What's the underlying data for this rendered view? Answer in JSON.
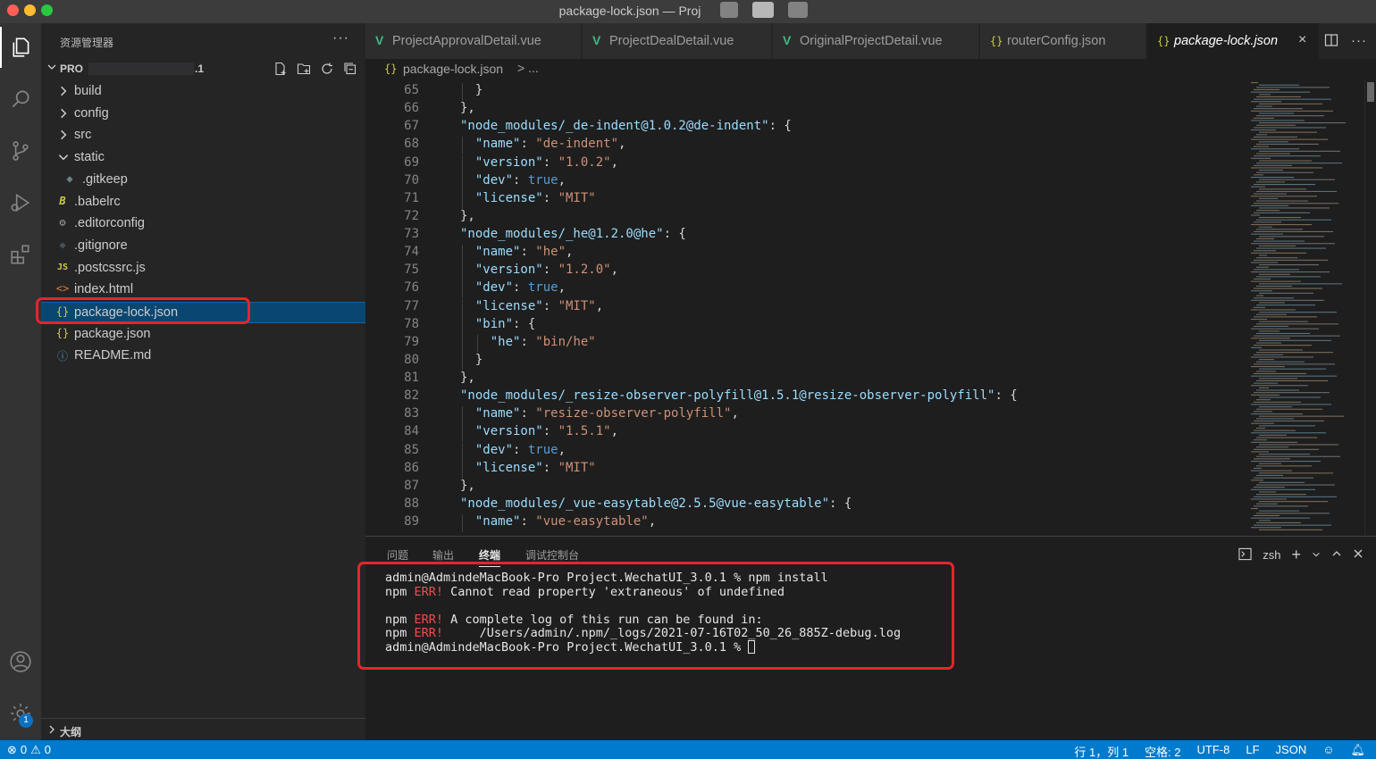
{
  "window": {
    "title": "package-lock.json — Proj"
  },
  "sidebar": {
    "title": "资源管理器",
    "more": "···",
    "project_prefix": "PRO",
    "project_suffix": ".1",
    "tree": [
      {
        "label": "build",
        "type": "folder",
        "expanded": false
      },
      {
        "label": "config",
        "type": "folder",
        "expanded": false
      },
      {
        "label": "src",
        "type": "folder",
        "expanded": false
      },
      {
        "label": "static",
        "type": "folder",
        "expanded": true
      },
      {
        "label": ".gitkeep",
        "type": "file",
        "icon": "◆",
        "icon_color": "#6d8086"
      },
      {
        "label": ".babelrc",
        "type": "file",
        "icon": "B",
        "icon_color": "#cbcb41"
      },
      {
        "label": ".editorconfig",
        "type": "file",
        "icon": "⚙",
        "icon_color": "#9d9d9d"
      },
      {
        "label": ".gitignore",
        "type": "file",
        "icon": "◆",
        "icon_color": "#41535b"
      },
      {
        "label": ".postcssrc.js",
        "type": "file",
        "icon": "JS",
        "icon_color": "#cbcb41"
      },
      {
        "label": "index.html",
        "type": "file",
        "icon": "<>",
        "icon_color": "#e37933"
      },
      {
        "label": "package-lock.json",
        "type": "file",
        "icon": "{}",
        "icon_color": "#cbcb41",
        "selected": true
      },
      {
        "label": "package.json",
        "type": "file",
        "icon": "{}",
        "icon_color": "#cbcb41"
      },
      {
        "label": "README.md",
        "type": "file",
        "icon": "ⓘ",
        "icon_color": "#519aba"
      }
    ],
    "outline_label": "大纲"
  },
  "tabs": [
    {
      "label": "ProjectApprovalDetail.vue",
      "kind": "vue"
    },
    {
      "label": "ProjectDealDetail.vue",
      "kind": "vue"
    },
    {
      "label": "OriginalProjectDetail.vue",
      "kind": "vue"
    },
    {
      "label": "routerConfig.json",
      "kind": "json"
    },
    {
      "label": "package-lock.json",
      "kind": "json",
      "active": true
    }
  ],
  "breadcrumb": {
    "file": "package-lock.json",
    "sep": "> ..."
  },
  "editor": {
    "lines": [
      {
        "n": "65",
        "indent": 2,
        "parts": [
          [
            "p",
            "}"
          ]
        ]
      },
      {
        "n": "66",
        "indent": 1,
        "parts": [
          [
            "p",
            "},"
          ]
        ]
      },
      {
        "n": "67",
        "indent": 1,
        "parts": [
          [
            "k",
            "\"node_modules/_de-indent@1.0.2@de-indent\""
          ],
          [
            "p",
            ": {"
          ]
        ]
      },
      {
        "n": "68",
        "indent": 2,
        "parts": [
          [
            "k",
            "\"name\""
          ],
          [
            "p",
            ": "
          ],
          [
            "s",
            "\"de-indent\""
          ],
          [
            "p",
            ","
          ]
        ]
      },
      {
        "n": "69",
        "indent": 2,
        "parts": [
          [
            "k",
            "\"version\""
          ],
          [
            "p",
            ": "
          ],
          [
            "s",
            "\"1.0.2\""
          ],
          [
            "p",
            ","
          ]
        ]
      },
      {
        "n": "70",
        "indent": 2,
        "parts": [
          [
            "k",
            "\"dev\""
          ],
          [
            "p",
            ": "
          ],
          [
            "b",
            "true"
          ],
          [
            "p",
            ","
          ]
        ]
      },
      {
        "n": "71",
        "indent": 2,
        "parts": [
          [
            "k",
            "\"license\""
          ],
          [
            "p",
            ": "
          ],
          [
            "s",
            "\"MIT\""
          ]
        ]
      },
      {
        "n": "72",
        "indent": 1,
        "parts": [
          [
            "p",
            "},"
          ]
        ]
      },
      {
        "n": "73",
        "indent": 1,
        "parts": [
          [
            "k",
            "\"node_modules/_he@1.2.0@he\""
          ],
          [
            "p",
            ": {"
          ]
        ]
      },
      {
        "n": "74",
        "indent": 2,
        "parts": [
          [
            "k",
            "\"name\""
          ],
          [
            "p",
            ": "
          ],
          [
            "s",
            "\"he\""
          ],
          [
            "p",
            ","
          ]
        ]
      },
      {
        "n": "75",
        "indent": 2,
        "parts": [
          [
            "k",
            "\"version\""
          ],
          [
            "p",
            ": "
          ],
          [
            "s",
            "\"1.2.0\""
          ],
          [
            "p",
            ","
          ]
        ]
      },
      {
        "n": "76",
        "indent": 2,
        "parts": [
          [
            "k",
            "\"dev\""
          ],
          [
            "p",
            ": "
          ],
          [
            "b",
            "true"
          ],
          [
            "p",
            ","
          ]
        ]
      },
      {
        "n": "77",
        "indent": 2,
        "parts": [
          [
            "k",
            "\"license\""
          ],
          [
            "p",
            ": "
          ],
          [
            "s",
            "\"MIT\""
          ],
          [
            "p",
            ","
          ]
        ]
      },
      {
        "n": "78",
        "indent": 2,
        "parts": [
          [
            "k",
            "\"bin\""
          ],
          [
            "p",
            ": {"
          ]
        ]
      },
      {
        "n": "79",
        "indent": 3,
        "parts": [
          [
            "k",
            "\"he\""
          ],
          [
            "p",
            ": "
          ],
          [
            "s",
            "\"bin/he\""
          ]
        ]
      },
      {
        "n": "80",
        "indent": 2,
        "parts": [
          [
            "p",
            "}"
          ]
        ]
      },
      {
        "n": "81",
        "indent": 1,
        "parts": [
          [
            "p",
            "},"
          ]
        ]
      },
      {
        "n": "82",
        "indent": 1,
        "parts": [
          [
            "k",
            "\"node_modules/_resize-observer-polyfill@1.5.1@resize-observer-polyfill\""
          ],
          [
            "p",
            ": {"
          ]
        ]
      },
      {
        "n": "83",
        "indent": 2,
        "parts": [
          [
            "k",
            "\"name\""
          ],
          [
            "p",
            ": "
          ],
          [
            "s",
            "\"resize-observer-polyfill\""
          ],
          [
            "p",
            ","
          ]
        ]
      },
      {
        "n": "84",
        "indent": 2,
        "parts": [
          [
            "k",
            "\"version\""
          ],
          [
            "p",
            ": "
          ],
          [
            "s",
            "\"1.5.1\""
          ],
          [
            "p",
            ","
          ]
        ]
      },
      {
        "n": "85",
        "indent": 2,
        "parts": [
          [
            "k",
            "\"dev\""
          ],
          [
            "p",
            ": "
          ],
          [
            "b",
            "true"
          ],
          [
            "p",
            ","
          ]
        ]
      },
      {
        "n": "86",
        "indent": 2,
        "parts": [
          [
            "k",
            "\"license\""
          ],
          [
            "p",
            ": "
          ],
          [
            "s",
            "\"MIT\""
          ]
        ]
      },
      {
        "n": "87",
        "indent": 1,
        "parts": [
          [
            "p",
            "},"
          ]
        ]
      },
      {
        "n": "88",
        "indent": 1,
        "parts": [
          [
            "k",
            "\"node_modules/_vue-easytable@2.5.5@vue-easytable\""
          ],
          [
            "p",
            ": {"
          ]
        ]
      },
      {
        "n": "89",
        "indent": 2,
        "parts": [
          [
            "k",
            "\"name\""
          ],
          [
            "p",
            ": "
          ],
          [
            "s",
            "\"vue-easytable\""
          ],
          [
            "p",
            ","
          ]
        ]
      }
    ]
  },
  "panel": {
    "tabs": [
      {
        "label": "问题"
      },
      {
        "label": "输出"
      },
      {
        "label": "终端",
        "active": true
      },
      {
        "label": "调试控制台"
      }
    ],
    "shell": "zsh",
    "terminal": [
      [
        [
          "t",
          "admin@AdmindeMacBook-Pro Project.WechatUI_3.0.1 % npm install"
        ]
      ],
      [
        [
          "t",
          "npm "
        ],
        [
          "e",
          "ERR!"
        ],
        [
          "t",
          " Cannot read property 'extraneous' of undefined"
        ]
      ],
      [
        [
          "t",
          ""
        ]
      ],
      [
        [
          "t",
          "npm "
        ],
        [
          "e",
          "ERR!"
        ],
        [
          "t",
          " A complete log of this run can be found in:"
        ]
      ],
      [
        [
          "t",
          "npm "
        ],
        [
          "e",
          "ERR!"
        ],
        [
          "t",
          "     /Users/admin/.npm/_logs/2021-07-16T02_50_26_885Z-debug.log"
        ]
      ],
      [
        [
          "t",
          "admin@AdmindeMacBook-Pro Project.WechatUI_3.0.1 % "
        ],
        [
          "c",
          ""
        ]
      ]
    ]
  },
  "status": {
    "errors": "0",
    "warnings": "0",
    "position": "行 1，列 1",
    "spaces": "空格: 2",
    "encoding": "UTF-8",
    "eol": "LF",
    "language": "JSON"
  },
  "activity": {
    "settings_badge": "1"
  }
}
